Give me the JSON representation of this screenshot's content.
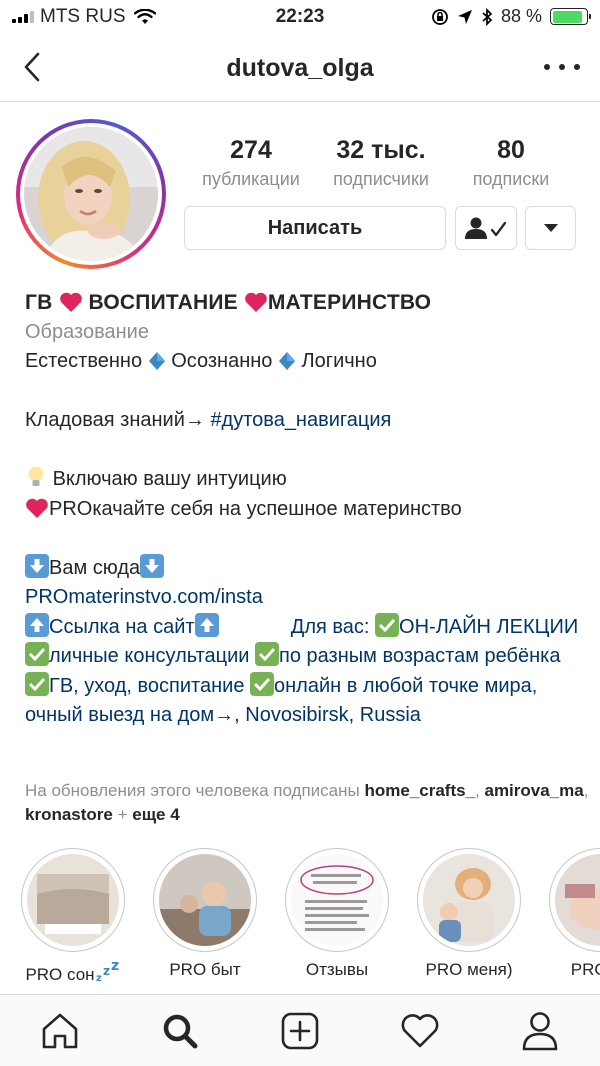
{
  "status_bar": {
    "carrier": "MTS RUS",
    "time": "22:23",
    "battery_percent": "88 %",
    "battery_level": 0.88
  },
  "header": {
    "username": "dutova_olga"
  },
  "stats": {
    "posts": {
      "value": "274",
      "label": "публикации"
    },
    "followers": {
      "value": "32 тыс.",
      "label": "подписчики"
    },
    "following": {
      "value": "80",
      "label": "подписки"
    }
  },
  "actions": {
    "message_label": "Написать"
  },
  "bio": {
    "name_part1": "ГВ ",
    "name_part2": " ВОСПИТАНИЕ ",
    "name_part3": "МАТЕРИНСТВО",
    "category": "Образование",
    "line1_a": "Естественно ",
    "line1_b": " Осознанно ",
    "line1_c": " Логично",
    "line2_prefix": "Кладовая знаний→ ",
    "line2_hashtag": "#дутова_навигация",
    "line3": "Включаю вашу интуицию",
    "line4": "PROкачайте себя на успешное материнство",
    "line5": "Вам сюда",
    "link": "PROmaterinstvo.com/insta",
    "address_a": "Ссылка на сайт",
    "address_b": "             Для вас: ",
    "address_c": "ОН-ЛАЙН ЛЕКЦИИ ",
    "address_d": "личные консультации ",
    "address_e": "по разным возрастам ребёнка ",
    "address_f": "ГВ, уход, воспитание ",
    "address_g": "онлайн в любой точке мира, очный выезд на дом→, Novosibirsk, Russia"
  },
  "followed_by": {
    "prefix": "На обновления этого человека подписаны ",
    "user1": "home_crafts_",
    "sep1": ", ",
    "user2": "amirova_ma",
    "sep2": ", ",
    "user3": "kronastore",
    "sep3": " + ",
    "more": "еще 4"
  },
  "highlights": [
    {
      "label": "PRO сон"
    },
    {
      "label": "PRO быт"
    },
    {
      "label": "Отзывы"
    },
    {
      "label": "PRO меня)"
    },
    {
      "label": "PRO дв"
    }
  ],
  "colors": {
    "link": "#003569",
    "secondary_text": "#8e8e8e",
    "border": "#dbdbdb",
    "battery_green": "#4cd964"
  }
}
